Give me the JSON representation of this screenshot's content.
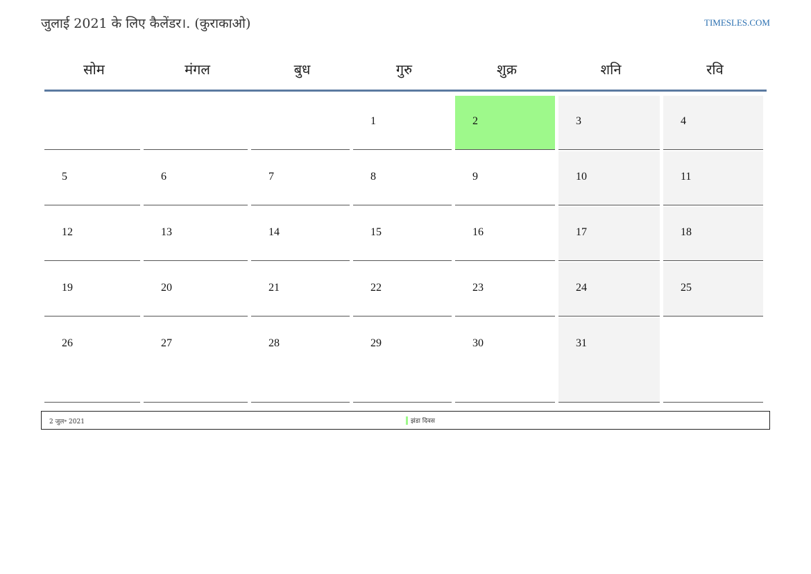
{
  "header": {
    "title": "जुलाई 2021 के लिए कैलेंडर।. (कुराकाओ)",
    "site_link": "TIMESLES.COM"
  },
  "calendar": {
    "day_names": [
      "सोम",
      "मंगल",
      "बुध",
      "गुरु",
      "शुक्र",
      "शनि",
      "रवि"
    ],
    "weeks": [
      [
        "",
        "",
        "",
        "1",
        "2",
        "3",
        "4"
      ],
      [
        "5",
        "6",
        "7",
        "8",
        "9",
        "10",
        "11"
      ],
      [
        "12",
        "13",
        "14",
        "15",
        "16",
        "17",
        "18"
      ],
      [
        "19",
        "20",
        "21",
        "22",
        "23",
        "24",
        "25"
      ],
      [
        "26",
        "27",
        "28",
        "29",
        "30",
        "31",
        ""
      ]
    ],
    "highlighted_day": "2",
    "colors": {
      "highlight": "#9ef98b",
      "weekend": "#f3f3f3",
      "header_rule": "#5b7aa0",
      "link": "#2a6fb0"
    }
  },
  "footer": {
    "holiday_date": "2 जुल॰ 2021",
    "legend_label": "झंडा दिवस"
  }
}
